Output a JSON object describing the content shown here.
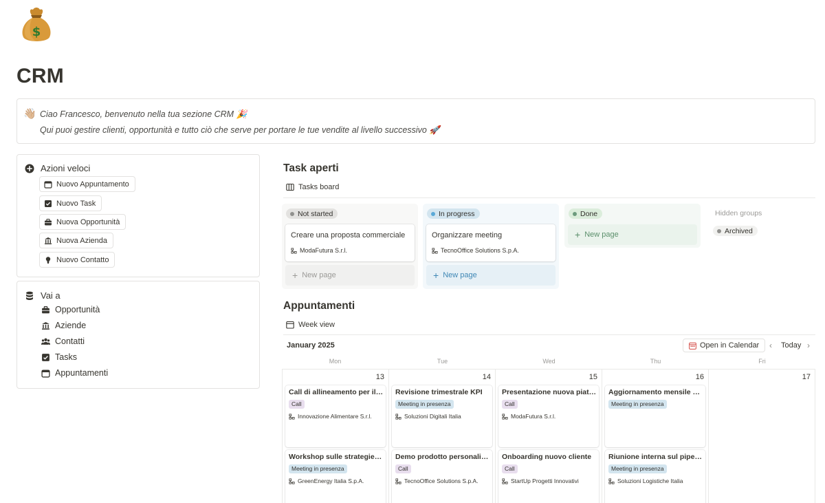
{
  "page": {
    "icon": "money-bag-icon",
    "title": "CRM"
  },
  "callout": {
    "line1": "Ciao Francesco, benvenuto nella tua sezione CRM 🎉",
    "line2": "Qui puoi gestire clienti, opportunità e tutto ciò che serve per portare le tue vendite al livello successivo 🚀"
  },
  "quick_actions": {
    "title": "Azioni veloci",
    "buttons": [
      {
        "label": "Nuovo Appuntamento",
        "icon": "calendar-icon"
      },
      {
        "label": "Nuovo Task",
        "icon": "checkbox-icon"
      },
      {
        "label": "Nuova Opportunità",
        "icon": "briefcase-icon"
      },
      {
        "label": "Nuova Azienda",
        "icon": "bank-icon"
      },
      {
        "label": "Nuovo Contatto",
        "icon": "person-icon"
      }
    ]
  },
  "go_to": {
    "title": "Vai a",
    "links": [
      {
        "label": "Opportunità",
        "icon": "briefcase-icon"
      },
      {
        "label": "Aziende",
        "icon": "bank-icon"
      },
      {
        "label": "Contatti",
        "icon": "people-icon"
      },
      {
        "label": "Tasks",
        "icon": "checkbox-icon"
      },
      {
        "label": "Appuntamenti",
        "icon": "calendar-icon"
      }
    ]
  },
  "tasks": {
    "title": "Task aperti",
    "view": "Tasks board",
    "new_page": "New page",
    "hidden_groups": "Hidden groups",
    "columns": [
      {
        "status": "Not started",
        "color": "#91918e",
        "pill_bg": "#e3e2e0",
        "card": {
          "title": "Creare una proposta commerciale",
          "company": "ModaFutura S.r.l."
        }
      },
      {
        "status": "In progress",
        "color": "#5aa9d7",
        "pill_bg": "#d3e5ef",
        "card": {
          "title": "Organizzare meeting",
          "company": "TecnoOffice Solutions S.p.A."
        }
      },
      {
        "status": "Done",
        "color": "#6c9b7d",
        "pill_bg": "#dbeddb"
      }
    ],
    "archived": "Archived"
  },
  "appointments": {
    "title": "Appuntamenti",
    "view": "Week view",
    "month": "January 2025",
    "open_calendar": "Open in Calendar",
    "today": "Today",
    "weekdays": [
      "Mon",
      "Tue",
      "Wed",
      "Thu",
      "Fri"
    ],
    "days": [
      "13",
      "14",
      "15",
      "16",
      "17"
    ],
    "events": [
      {
        "title": "Call di allineamento per il lancio",
        "tag": "Call",
        "company": "Innovazione Alimentare S.r.l."
      },
      {
        "title": "Revisione trimestrale KPI",
        "tag": "Meeting in presenza",
        "company": "Soluzioni Digitali Italia"
      },
      {
        "title": "Presentazione nuova piattaforma",
        "tag": "Call",
        "company": "ModaFutura S.r.l."
      },
      {
        "title": "Aggiornamento mensile clienti",
        "tag": "Meeting in presenza",
        "company": ""
      },
      {
        "title": "Workshop sulle strategie di vendita",
        "tag": "Meeting in presenza",
        "company": "GreenEnergy Italia S.p.A."
      },
      {
        "title": "Demo prodotto personalizzata",
        "tag": "Call",
        "company": "TecnoOffice Solutions S.p.A."
      },
      {
        "title": "Onboarding nuovo cliente",
        "tag": "Call",
        "company": "StartUp Progetti Innovativi"
      },
      {
        "title": "Riunione interna sul pipeline",
        "tag": "Meeting in presenza",
        "company": "Soluzioni Logistiche Italia"
      }
    ]
  }
}
